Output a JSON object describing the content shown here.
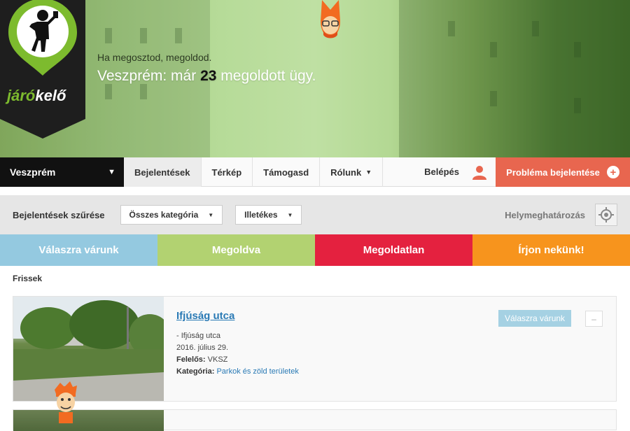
{
  "brand": {
    "logo_text_part1": "járó",
    "logo_text_part2": "kelő"
  },
  "hero": {
    "tagline": "Ha megosztod, megoldod.",
    "headline_prefix": "Veszprém: már",
    "solved_count": "23",
    "headline_suffix": "megoldott ügy."
  },
  "nav": {
    "city": "Veszprém",
    "items": [
      {
        "label": "Bejelentések"
      },
      {
        "label": "Térkép"
      },
      {
        "label": "Támogasd"
      },
      {
        "label": "Rólunk"
      }
    ],
    "login": "Belépés",
    "report_button": "Probléma bejelentése"
  },
  "filter": {
    "label": "Bejelentések szűrése",
    "category_select": "Összes kategória",
    "authority_select": "Illetékes",
    "geolocation": "Helymeghatározás"
  },
  "status_tabs": [
    {
      "label": "Válaszra várunk"
    },
    {
      "label": "Megoldva"
    },
    {
      "label": "Megoldatlan"
    },
    {
      "label": "Írjon nekünk!"
    }
  ],
  "section": {
    "title": "Frissek"
  },
  "reports": [
    {
      "title": "Ifjúság utca",
      "address": "- Ifjúság utca",
      "date": "2016. július 29.",
      "responsible_label": "Felelős:",
      "responsible": "VKSZ",
      "category_label": "Kategória:",
      "category": "Parkok és zöld területek",
      "status": "Válaszra várunk",
      "collapse": "–"
    }
  ],
  "colors": {
    "status_waiting": "#94c9e0",
    "status_solved": "#b2d271",
    "status_unsolved": "#e4213f",
    "status_write": "#f7941d",
    "report_button": "#e8664f",
    "brand_green": "#7dbb2e"
  }
}
